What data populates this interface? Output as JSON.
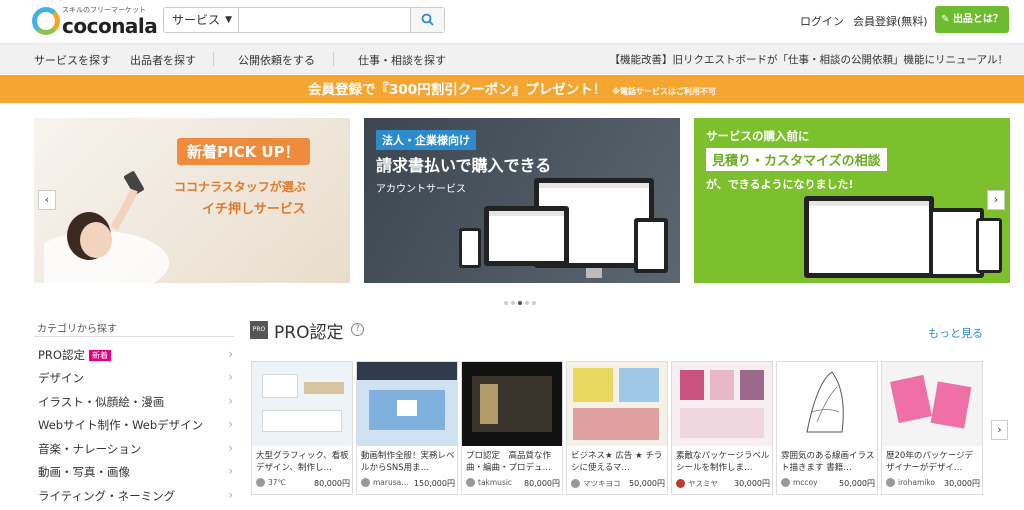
{
  "header": {
    "logo_sub": "スキルのフリーマーケット",
    "logo_name": "coconala",
    "search_category": "サービス",
    "search_placeholder": "",
    "login": "ログイン",
    "register": "会員登録(無料)",
    "seller_button": "出品とは？"
  },
  "nav": {
    "items": [
      "サービスを探す",
      "出品者を探す",
      "公開依頼をする",
      "仕事・相談を探す"
    ],
    "notice": "【機能改善】旧リクエストボードが「仕事・相談の公開依頼」機能にリニューアル！"
  },
  "promo": {
    "main": "会員登録で『300円割引クーポン』プレゼント！",
    "note": "※電話サービスはご利用不可"
  },
  "banners": [
    {
      "tag": "新着PICK UP！",
      "line1": "ココナラスタッフが選ぶ",
      "line2": "イチ押しサービス"
    },
    {
      "tag": "法人・企業様向け",
      "title": "請求書払いで購入できる",
      "sub": "アカウントサービス"
    },
    {
      "line1": "サービスの購入前に",
      "highlight": "見積り・カスタマイズの相談",
      "line3": "が、できるようになりました!"
    }
  ],
  "carousel": {
    "dots": 5,
    "active": 2
  },
  "sidebar": {
    "title": "カテゴリから探す",
    "new_badge": "新着",
    "items": [
      "PRO認定",
      "デザイン",
      "イラスト・似顔絵・漫画",
      "Webサイト制作・Webデザイン",
      "音楽・ナレーション",
      "動画・写真・画像",
      "ライティング・ネーミング"
    ]
  },
  "pro": {
    "badge": "PRO",
    "title": "PRO認定",
    "more": "もっと見る",
    "cards": [
      {
        "desc": "大型グラフィック、看板デザイン、制作し…",
        "seller": "37℃",
        "price": "80,000円"
      },
      {
        "desc": "動画制作全般！実務レベルからSNS用ま…",
        "seller": "marusa…",
        "price": "150,000円"
      },
      {
        "desc": "プロ認定　高品質な作曲・編曲・プロデュ…",
        "seller": "takmusic",
        "price": "80,000円"
      },
      {
        "desc": "ビジネス★ 広告 ★ チラシに使えるマ…",
        "seller": "マツキヨコ",
        "price": "50,000円"
      },
      {
        "desc": "素敵なパッケージラベルシールを制作しま…",
        "seller": "ヤスミヤ",
        "price": "30,000円"
      },
      {
        "desc": "雰囲気のある線画イラスト描きます 書籍…",
        "seller": "mccoy",
        "price": "50,000円"
      },
      {
        "desc": "歴20年のパッケージデザイナーがデザイ…",
        "seller": "irohamiko",
        "price": "30,000円"
      }
    ]
  }
}
